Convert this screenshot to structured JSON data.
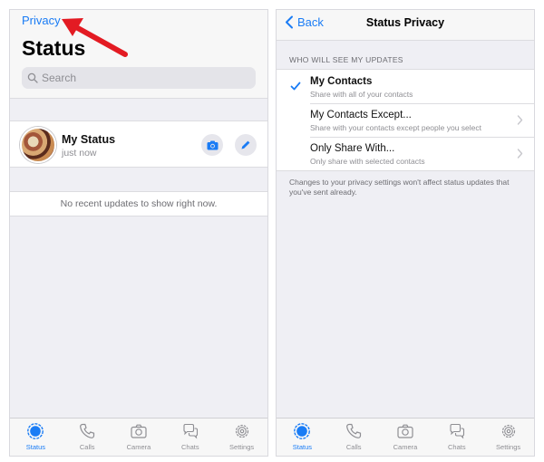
{
  "left": {
    "privacy_link": "Privacy",
    "title": "Status",
    "search": {
      "placeholder": "Search"
    },
    "my_status": {
      "name": "My Status",
      "subtitle": "just now"
    },
    "empty_message": "No recent updates to show right now."
  },
  "right": {
    "back_label": "Back",
    "title": "Status Privacy",
    "section_header": "WHO WILL SEE MY UPDATES",
    "options": [
      {
        "label": "My Contacts",
        "description": "Share with all of your contacts",
        "selected": true
      },
      {
        "label": "My Contacts Except...",
        "description": "Share with your contacts except people you select",
        "selected": false
      },
      {
        "label": "Only Share With...",
        "description": "Only share with selected contacts",
        "selected": false
      }
    ],
    "footer_note": "Changes to your privacy settings won't affect status updates that you've sent already."
  },
  "tabbar": {
    "tabs": [
      {
        "label": "Status",
        "icon": "status-icon",
        "active": true
      },
      {
        "label": "Calls",
        "icon": "phone-icon",
        "active": false
      },
      {
        "label": "Camera",
        "icon": "camera-icon",
        "active": false
      },
      {
        "label": "Chats",
        "icon": "chat-icon",
        "active": false
      },
      {
        "label": "Settings",
        "icon": "gear-icon",
        "active": false
      }
    ]
  },
  "colors": {
    "accent": "#1a7cf5",
    "arrow": "#e31b23",
    "inactive": "#8e8e93"
  }
}
